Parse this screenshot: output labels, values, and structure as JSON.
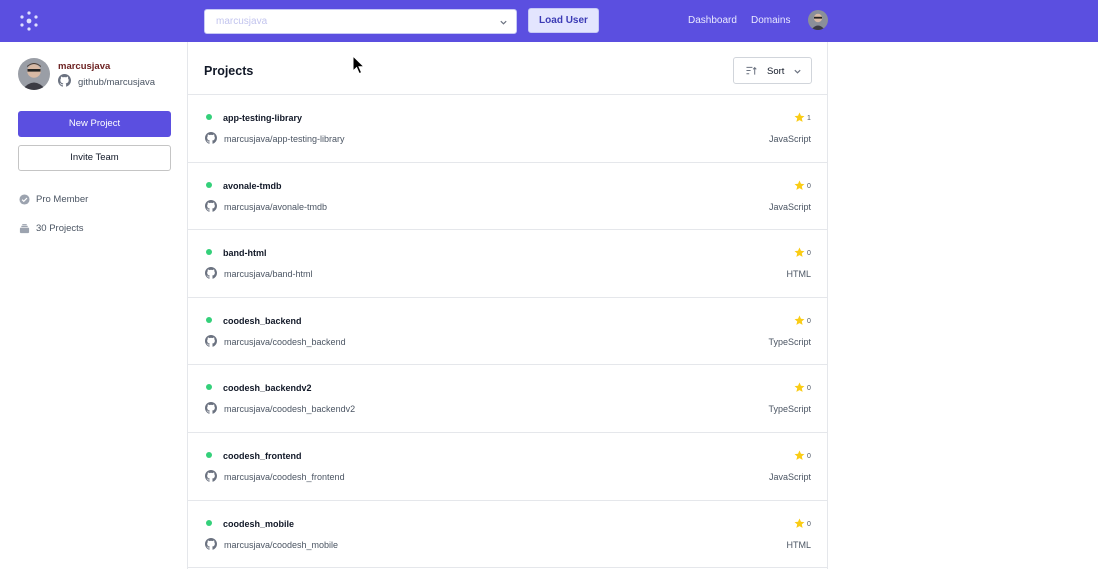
{
  "topbar": {
    "logo_icon": "asterisk-logo-icon",
    "user_select_value": "marcusjava",
    "load_button": "Load User",
    "nav": {
      "dashboard": "Dashboard",
      "domains": "Domains"
    },
    "brand_color": "#5b4fe0"
  },
  "sidebar": {
    "username": "marcusjava",
    "github_link": "github/marcusjava",
    "new_project": "New Project",
    "invite_team": "Invite Team",
    "pro_member": "Pro Member",
    "projects_count": "30 Projects"
  },
  "main": {
    "title": "Projects",
    "sort_label": "Sort",
    "projects": [
      {
        "name": "app-testing-library",
        "path": "marcusjava/app-testing-library",
        "stars": "1",
        "language": "JavaScript"
      },
      {
        "name": "avonale-tmdb",
        "path": "marcusjava/avonale-tmdb",
        "stars": "0",
        "language": "JavaScript"
      },
      {
        "name": "band-html",
        "path": "marcusjava/band-html",
        "stars": "0",
        "language": "HTML"
      },
      {
        "name": "coodesh_backend",
        "path": "marcusjava/coodesh_backend",
        "stars": "0",
        "language": "TypeScript"
      },
      {
        "name": "coodesh_backendv2",
        "path": "marcusjava/coodesh_backendv2",
        "stars": "0",
        "language": "TypeScript"
      },
      {
        "name": "coodesh_frontend",
        "path": "marcusjava/coodesh_frontend",
        "stars": "0",
        "language": "JavaScript"
      },
      {
        "name": "coodesh_mobile",
        "path": "marcusjava/coodesh_mobile",
        "stars": "0",
        "language": "HTML"
      }
    ]
  }
}
